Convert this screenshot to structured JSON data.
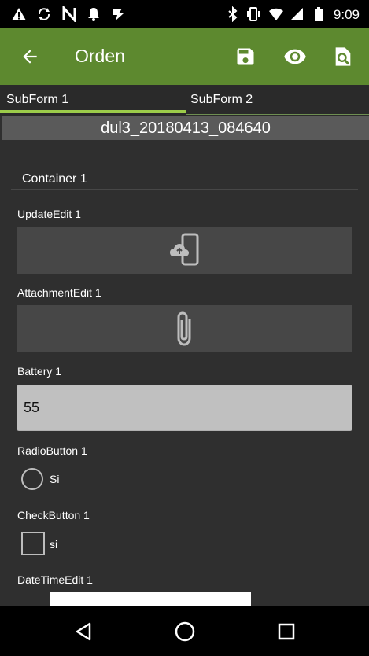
{
  "status_bar": {
    "time": "9:09",
    "icons": [
      "warning-icon",
      "sync-icon",
      "n-icon",
      "notification-bell-icon",
      "download-icon",
      "bluetooth-icon",
      "vibrate-icon",
      "wifi-icon",
      "signal-icon",
      "battery-icon"
    ]
  },
  "app_bar": {
    "title": "Orden",
    "actions": [
      "back-icon",
      "save-icon",
      "preview-eye-icon",
      "search-doc-icon"
    ]
  },
  "tabs": [
    {
      "label": "SubForm 1",
      "selected": true
    },
    {
      "label": "SubForm 2",
      "selected": false
    }
  ],
  "document_name": "dul3_20180413_084640",
  "container": {
    "label": "Container 1"
  },
  "fields": {
    "update_edit": {
      "label": "UpdateEdit 1"
    },
    "attachment_edit": {
      "label": "AttachmentEdit 1"
    },
    "battery": {
      "label": "Battery 1",
      "value": "55"
    },
    "radio_button": {
      "label": "RadioButton 1",
      "option": "Si",
      "checked": false
    },
    "check_button": {
      "label": "CheckButton 1",
      "option": "si",
      "checked": false
    },
    "datetime_edit": {
      "label": "DateTimeEdit 1"
    }
  },
  "colors": {
    "app_bar": "#5d892f",
    "tab_indicator": "#9ccc4a",
    "background": "#2f2f2f",
    "block": "#474747",
    "battery_input": "#c0c0c0"
  }
}
